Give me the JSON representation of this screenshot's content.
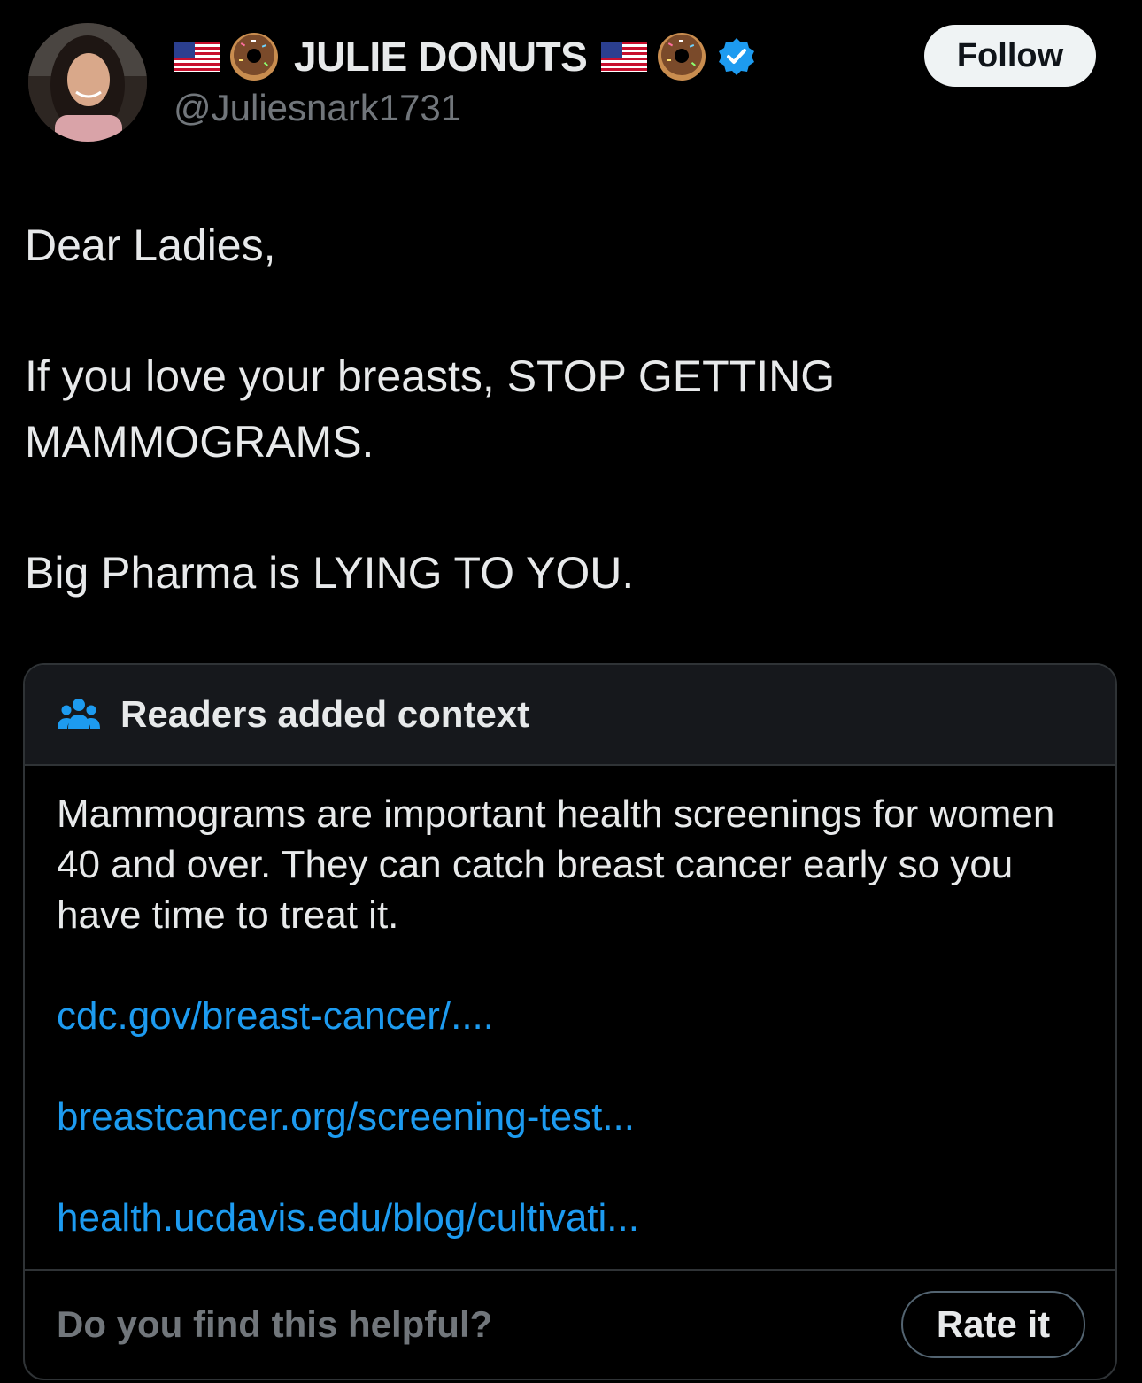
{
  "author": {
    "display_name": "JULIE DONUTS",
    "handle": "@Juliesnark1731",
    "verified": true,
    "name_emoji": [
      "us-flag-icon",
      "donut-icon"
    ],
    "avatar": "profile-photo"
  },
  "follow_label": "Follow",
  "tweet": {
    "line1": "Dear Ladies,",
    "line2": "If you love your breasts, STOP GETTING MAMMOGRAMS.",
    "line3": "Big Pharma is LYING TO YOU."
  },
  "community_note": {
    "title": "Readers added context",
    "icon": "people-icon",
    "text": "Mammograms are important health screenings for women 40 and over. They can catch breast cancer early so you have time to treat it.",
    "links": [
      "cdc.gov/breast-cancer/....",
      "breastcancer.org/screening-test...",
      "health.ucdavis.edu/blog/cultivati..."
    ],
    "helpful_question": "Do you find this helpful?",
    "rate_label": "Rate it"
  },
  "colors": {
    "background": "#000000",
    "text": "#e7e9ea",
    "secondary": "#71767b",
    "link": "#1d9bf0",
    "verified": "#1d9bf0",
    "border": "#2f3336"
  }
}
